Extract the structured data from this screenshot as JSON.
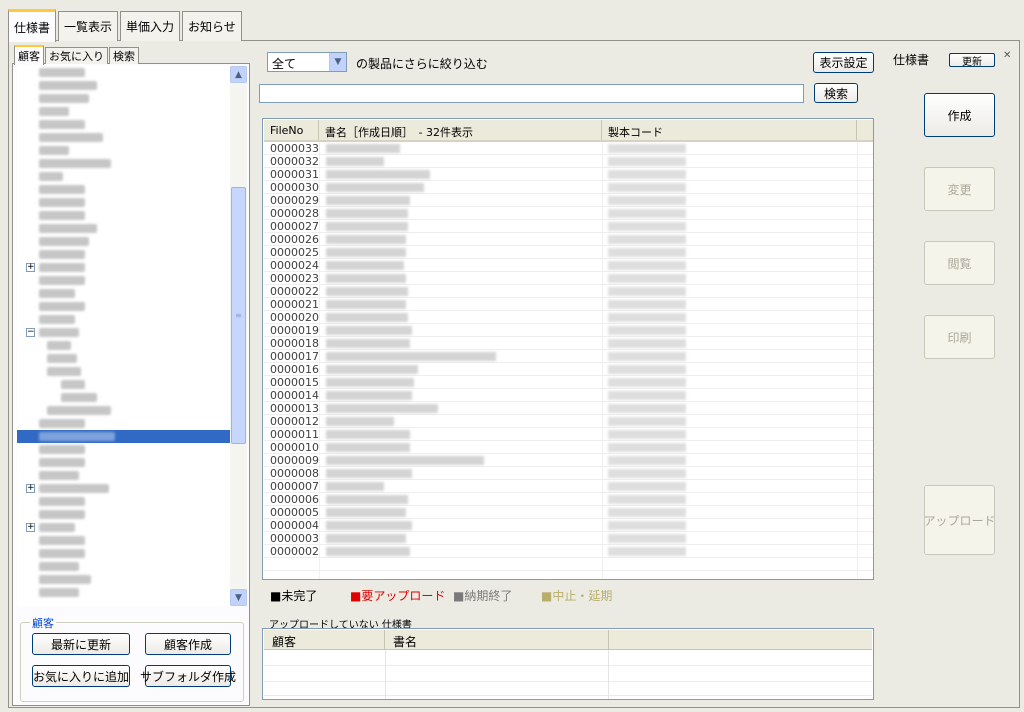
{
  "top_tabs": [
    "仕様書",
    "一覧表示",
    "単価入力",
    "お知らせ"
  ],
  "sub_tabs": [
    "顧客",
    "お気に入り",
    "検索"
  ],
  "left_group": {
    "legend": "顧客",
    "buttons": {
      "refresh": "最新に更新",
      "create_customer": "顧客作成",
      "add_favorite": "お気に入りに追加",
      "create_subfolder": "サブフォルダ作成"
    }
  },
  "filter": {
    "selected": "全て",
    "label": "の製品にさらに絞り込む",
    "display_settings": "表示設定",
    "search_button": "検索",
    "search_value": ""
  },
  "list": {
    "columns": [
      "FileNo",
      "書名［作成日順］　- 32件表示",
      "製本コード"
    ],
    "file_numbers": [
      "0000033",
      "0000032",
      "0000031",
      "0000030",
      "0000029",
      "0000028",
      "0000027",
      "0000026",
      "0000025",
      "0000024",
      "0000023",
      "0000022",
      "0000021",
      "0000020",
      "0000019",
      "0000018",
      "0000017",
      "0000016",
      "0000015",
      "0000014",
      "0000013",
      "0000012",
      "0000011",
      "0000010",
      "0000009",
      "0000008",
      "0000007",
      "0000006",
      "0000005",
      "0000004",
      "0000003",
      "0000002"
    ]
  },
  "status_legend": [
    {
      "label": "■未完了",
      "color": "#000000"
    },
    {
      "label": "■要アップロード",
      "color": "#e00000"
    },
    {
      "label": "■納期終了",
      "color": "#7a7a7a"
    },
    {
      "label": "■中止・延期",
      "color": "#b8ae6a"
    }
  ],
  "upload_section": {
    "caption": "アップロードしていない 仕様書",
    "columns": [
      "顧客",
      "書名"
    ]
  },
  "right_panel": {
    "title": "仕様書",
    "refresh": "更新",
    "close": "✕",
    "buttons": {
      "create": "作成",
      "change": "変更",
      "view": "閲覧",
      "print": "印刷",
      "upload": "アップロード"
    }
  },
  "icons": {
    "scroll_up": "scroll-up-icon",
    "scroll_down": "scroll-down-icon",
    "dropdown": "chevron-down-icon",
    "tree_expand": "plus-icon",
    "tree_collapse": "minus-icon"
  }
}
